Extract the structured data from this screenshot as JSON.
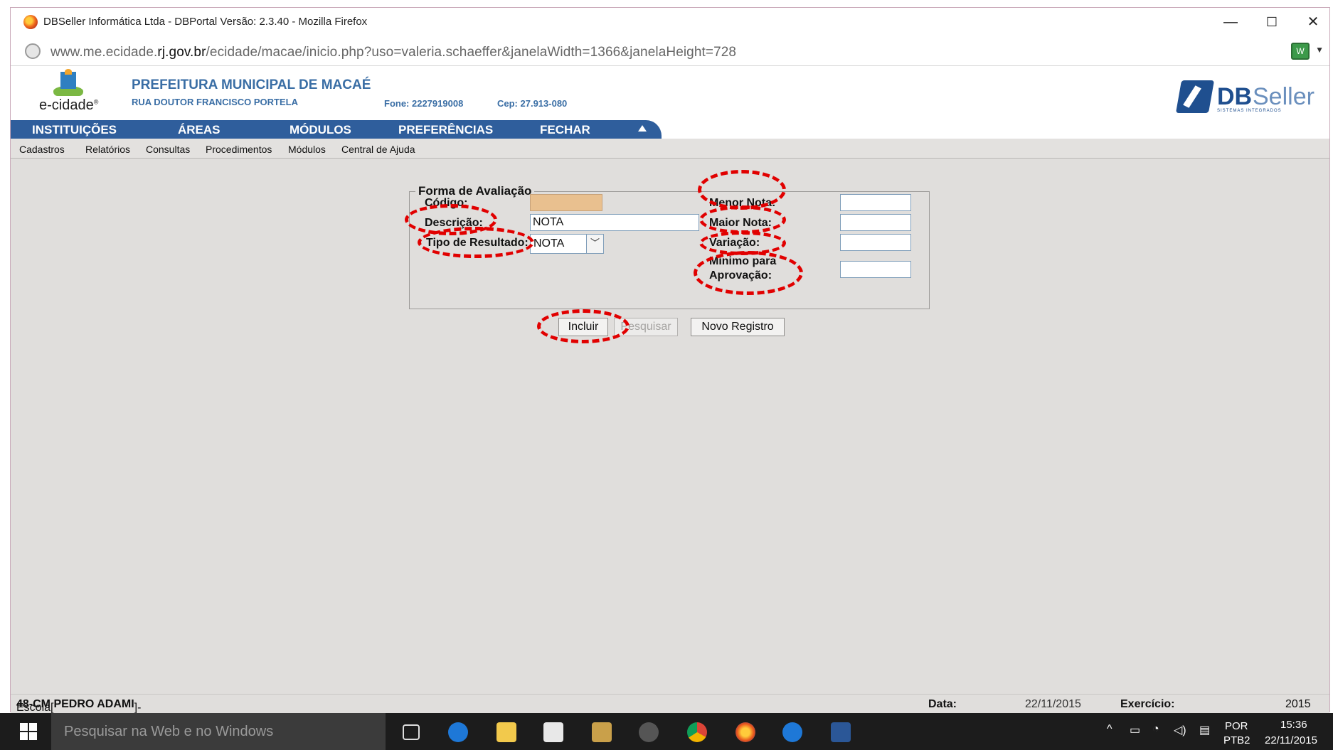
{
  "browser": {
    "window_title": "DBSeller Informática Ltda - DBPortal Versão: 2.3.40 - Mozilla Firefox",
    "url_prefix": "www.me.ecidade.",
    "url_domain": "rj.gov.br",
    "url_rest": "/ecidade/macae/inicio.php?uso=valeria.schaeffer&janelaWidth=1366&janelaHeight=728",
    "minimize": "—",
    "maximize": "☐",
    "close": "✕"
  },
  "header": {
    "logo_text": "e-cidade",
    "logo_reg": "®",
    "org_name": "PREFEITURA MUNICIPAL DE MACAÉ",
    "address": "RUA DOUTOR FRANCISCO PORTELA",
    "phone": "Fone: 2227919008",
    "cep": "Cep: 27.913-080",
    "brand_db": "DB",
    "brand_seller": "Seller",
    "brand_tag": "SISTEMAS INTEGRADOS"
  },
  "mainnav": [
    "INSTITUIÇÕES",
    "ÁREAS",
    "MÓDULOS",
    "PREFERÊNCIAS",
    "FECHAR"
  ],
  "submenu": [
    "Cadastros",
    "Relatórios",
    "Consultas",
    "Procedimentos",
    "Módulos",
    "Central de Ajuda"
  ],
  "form": {
    "legend": "Forma de Avaliação",
    "codigo_label": "Código:",
    "codigo_value": "",
    "descricao_label": "Descrição:",
    "descricao_value": "NOTA",
    "tipo_label": "Tipo de Resultado:",
    "tipo_value": "NOTA",
    "menor_label": "Menor Nota:",
    "menor_value": "",
    "maior_label": "Maior Nota:",
    "maior_value": "",
    "variacao_label": "Variação:",
    "variacao_value": "",
    "minimo_label_1": "Mínimo para",
    "minimo_label_2": "Aprovação:",
    "minimo_value": ""
  },
  "buttons": {
    "incluir": "Incluir",
    "pesquisar": "Pesquisar",
    "novo": "Novo Registro"
  },
  "status": {
    "escola_prefix": "Escola[",
    "escola_name": "48-CM PEDRO ADAMI",
    "escola_suffix": "]->",
    "data_label": "Data:",
    "data_value": "22/11/2015",
    "exercicio_label": "Exercício:",
    "exercicio_value": "2015"
  },
  "taskbar": {
    "search_placeholder": "Pesquisar na Web e no Windows",
    "lang_1": "POR",
    "lang_2": "PTB2",
    "time": "15:36",
    "date": "22/11/2015"
  },
  "colors": {
    "nav_blue": "#2f5e9c",
    "header_text_blue": "#3a6ea5",
    "annotation_red": "#e10000",
    "codigo_bg": "#e9c08f"
  }
}
